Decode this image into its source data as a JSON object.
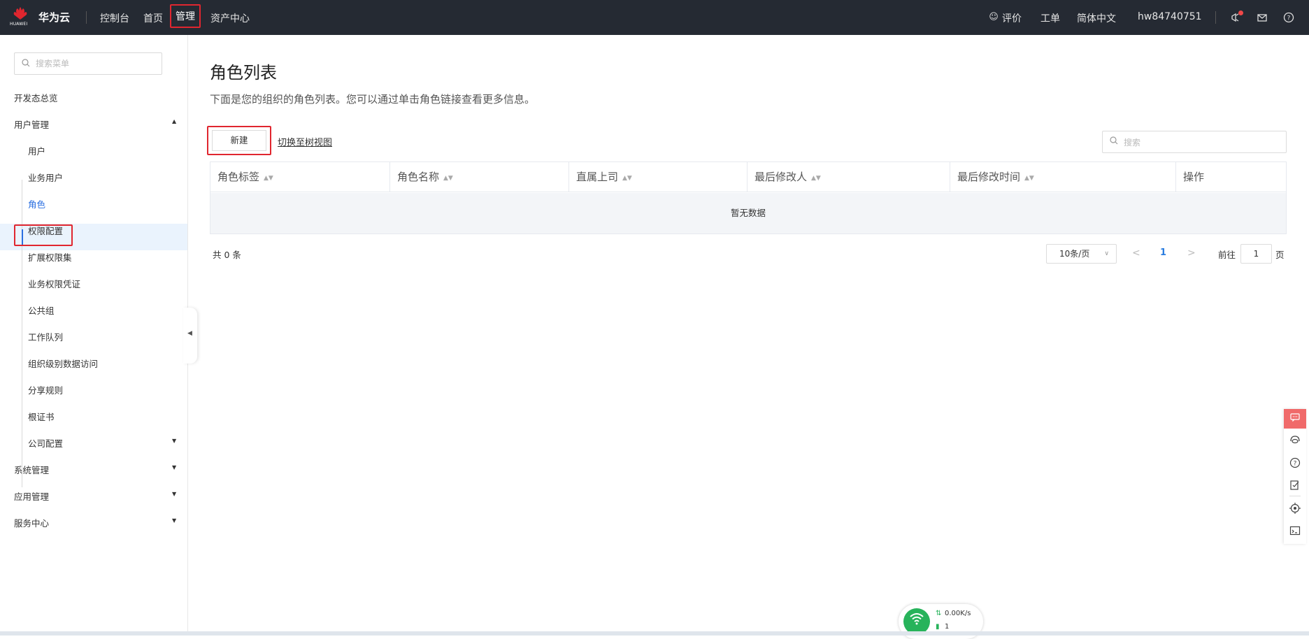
{
  "topbar": {
    "logo_text": "HUAWEI",
    "brand": "华为云",
    "nav": [
      "控制台",
      "首页",
      "管理",
      "资产中心"
    ],
    "right": {
      "feedback": "评价",
      "ticket": "工单",
      "language": "简体中文",
      "username": "hw84740751"
    }
  },
  "sidebar": {
    "search_placeholder": "搜索菜单",
    "items": {
      "overview": "开发态总览",
      "user_mgmt": "用户管理",
      "users": "用户",
      "business_users": "业务用户",
      "roles": "角色",
      "permission_config": "权限配置",
      "ext_permission_set": "扩展权限集",
      "business_permission_cert": "业务权限凭证",
      "public_group": "公共组",
      "work_queue": "工作队列",
      "org_data_access": "组织级别数据访问",
      "share_rules": "分享规则",
      "root_cert": "根证书",
      "company_config": "公司配置",
      "system_mgmt": "系统管理",
      "app_mgmt": "应用管理",
      "service_center": "服务中心"
    }
  },
  "main": {
    "title": "角色列表",
    "description": "下面是您的组织的角色列表。您可以通过单击角色链接查看更多信息。",
    "new_button": "新建",
    "tree_view_link": "切换至树视图",
    "search_placeholder": "搜索",
    "columns": [
      "角色标签",
      "角色名称",
      "直属上司",
      "最后修改人",
      "最后修改时间",
      "操作"
    ],
    "empty_text": "暂无数据",
    "total": "共 0 条",
    "page_size": "10条/页",
    "current_page": "1",
    "goto_label": "前往",
    "goto_value": "1",
    "goto_suffix": "页"
  },
  "network_widget": {
    "speed": "0.00K/s",
    "count": "1"
  },
  "colors": {
    "topbar_bg": "#252a33",
    "highlight_red": "#e0262f",
    "active_blue": "#2b6fe0",
    "active_row_bg": "#eaf3fd",
    "float_accent": "#f06a6a",
    "net_green": "#27b35b"
  }
}
